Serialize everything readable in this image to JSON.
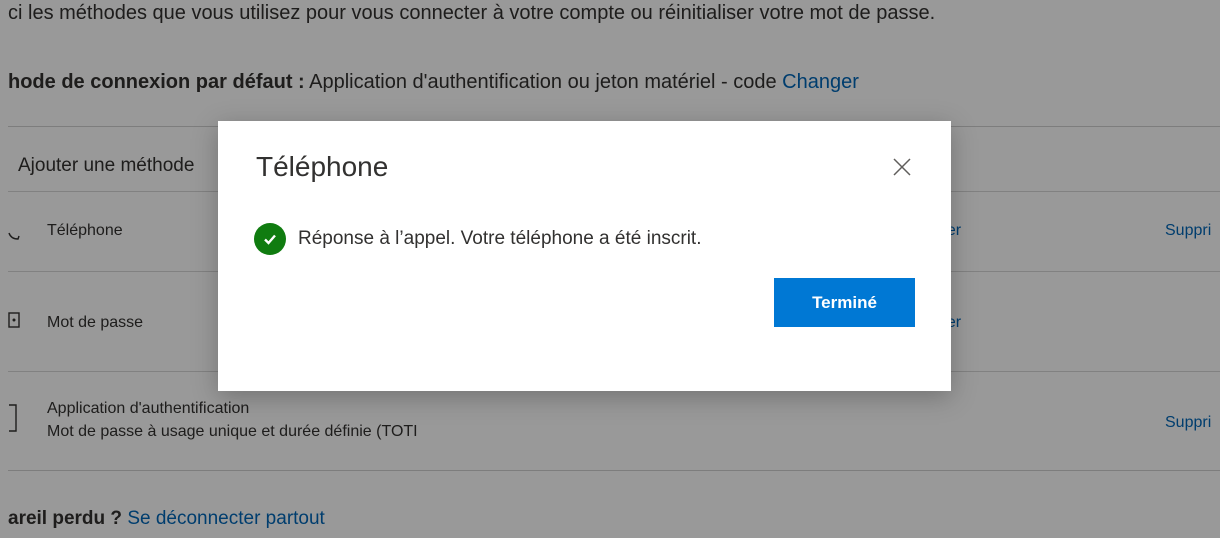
{
  "page": {
    "intro": "ci les méthodes que vous utilisez pour vous connecter à votre compte ou réinitialiser votre mot de passe.",
    "default_method_label": "hode de connexion par défaut :",
    "default_method_value": "Application d'authentification ou jeton matériel - code",
    "default_method_change": "Changer",
    "add_method": "Ajouter une méthode",
    "methods": [
      {
        "icon": "phone-icon",
        "name": "Téléphone",
        "change": "ger",
        "delete": "Suppri"
      },
      {
        "icon": "password-icon",
        "name": "Mot de passe",
        "change": "ger",
        "delete": ""
      },
      {
        "icon": "authenticator-icon",
        "name": "Application d'authentification",
        "sub": "Mot de passe à usage unique et durée définie (TOTI",
        "delete": "Suppri"
      }
    ],
    "lost_label": "areil perdu ?",
    "lost_link": "Se déconnecter partout"
  },
  "dialog": {
    "title": "Téléphone",
    "message": "Réponse à l’appel. Votre téléphone a été inscrit.",
    "done_label": "Terminé"
  },
  "colors": {
    "accent": "#0078d4",
    "link": "#0067b8",
    "success": "#107c10"
  }
}
